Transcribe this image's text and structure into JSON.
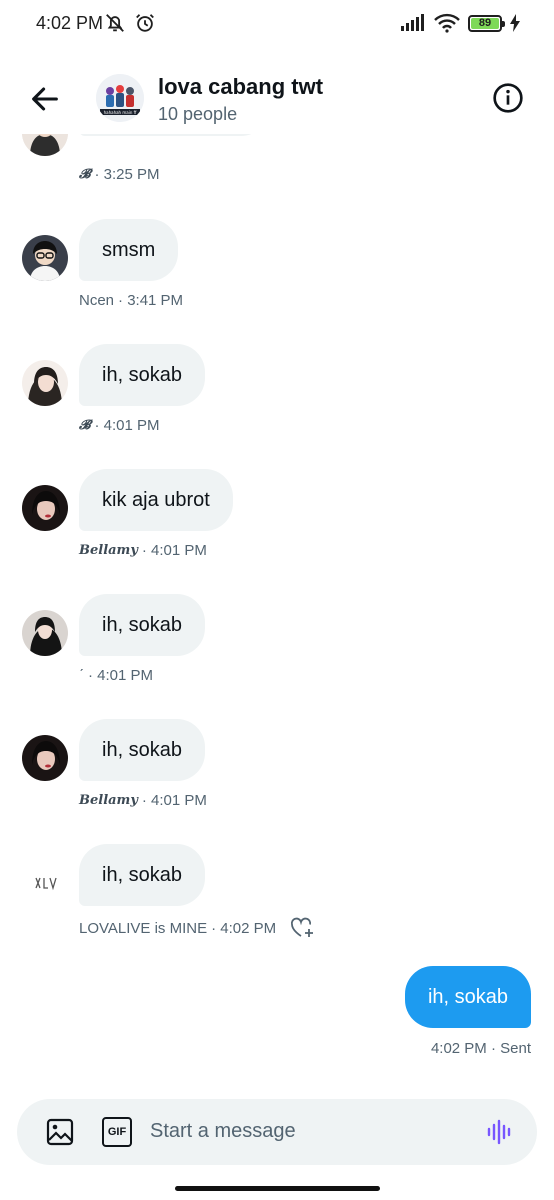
{
  "status_bar": {
    "time": "4:02 PM",
    "battery": "89"
  },
  "header": {
    "title": "lova cabang twt",
    "subtitle": "10 people",
    "group_avatar_caption": "hahahah main ff"
  },
  "messages": [
    {
      "sender": "𝓑",
      "time": "· 3:25 PM"
    },
    {
      "text": "smsm",
      "sender": "Ncen",
      "time": "· 3:41 PM"
    },
    {
      "text": "ih, sokab",
      "sender": "𝓑",
      "time": "· 4:01 PM"
    },
    {
      "text": "kik aja ubrot",
      "sender": "Bellamy",
      "time": "· 4:01 PM"
    },
    {
      "text": "ih, sokab",
      "sender": "ˊ",
      "time": "· 4:01 PM"
    },
    {
      "text": "ih, sokab",
      "sender": "Bellamy",
      "time": "· 4:01 PM"
    },
    {
      "text": "ih, sokab",
      "sender": "LOVALIVE is MINE",
      "time": "· 4:02 PM"
    }
  ],
  "sent": {
    "text": "ih, sokab",
    "meta": "4:02 PM · Sent"
  },
  "composer": {
    "placeholder": "Start a message",
    "gif_label": "GIF"
  },
  "colors": {
    "accent": "#1d9bf0",
    "bubble": "#eff3f4",
    "mic": "#7856ff"
  }
}
